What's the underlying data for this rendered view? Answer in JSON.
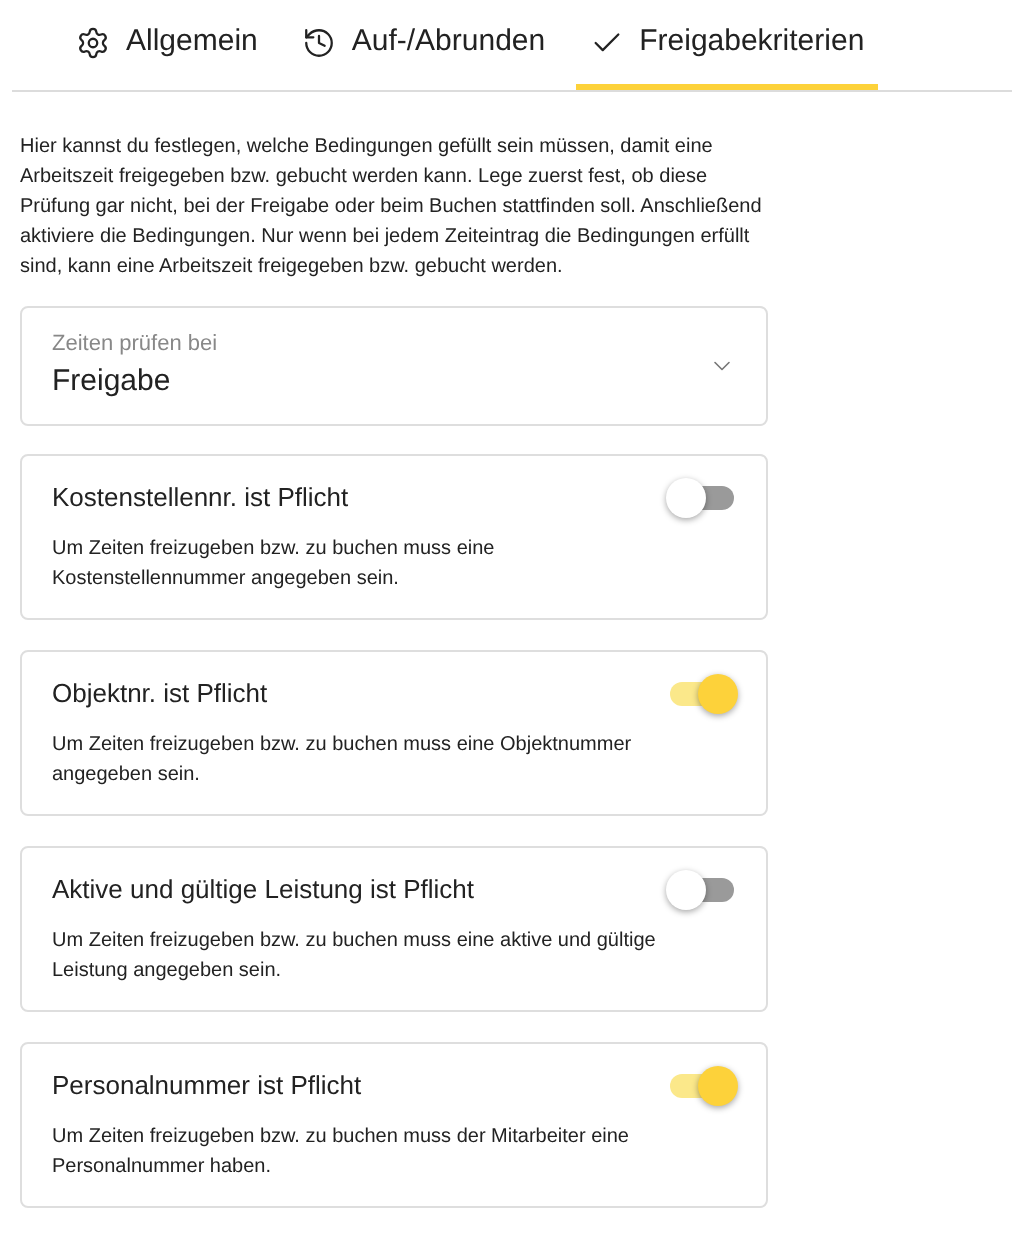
{
  "tabs": [
    {
      "label": "Allgemein",
      "kind": "gear",
      "selected": false
    },
    {
      "label": "Auf-/Abrunden",
      "kind": "history",
      "selected": false
    },
    {
      "label": "Freigabekriterien",
      "kind": "check",
      "selected": true
    }
  ],
  "intro": "Hier kannst du festlegen, welche Bedingungen gefüllt sein müssen, damit eine Arbeitszeit freigegeben bzw. gebucht werden kann. Lege zuerst fest, ob diese Prüfung gar nicht, bei der Freigabe oder beim Buchen stattfinden soll. Anschließend aktiviere die Bedingungen. Nur wenn bei jedem Zeiteintrag die Bedingungen erfüllt sind, kann eine Arbeitszeit freigegeben bzw. gebucht werden.",
  "select": {
    "label": "Zeiten prüfen bei",
    "value": "Freigabe"
  },
  "conditions": [
    {
      "title": "Kostenstellennr. ist Pflicht",
      "description": "Um Zeiten freizugeben bzw. zu buchen muss eine Kostenstellennummer angegeben sein.",
      "on": false
    },
    {
      "title": "Objektnr. ist Pflicht",
      "description": "Um Zeiten freizugeben bzw. zu buchen muss eine Objektnummer angegeben sein.",
      "on": true
    },
    {
      "title": "Aktive und gültige Leistung ist Pflicht",
      "description": "Um Zeiten freizugeben bzw. zu buchen muss eine aktive und gültige Leistung angegeben sein.",
      "on": false
    },
    {
      "title": "Personalnummer ist Pflicht",
      "description": "Um Zeiten freizugeben bzw. zu buchen muss der Mitarbeiter eine Personalnummer haben.",
      "on": true
    }
  ]
}
